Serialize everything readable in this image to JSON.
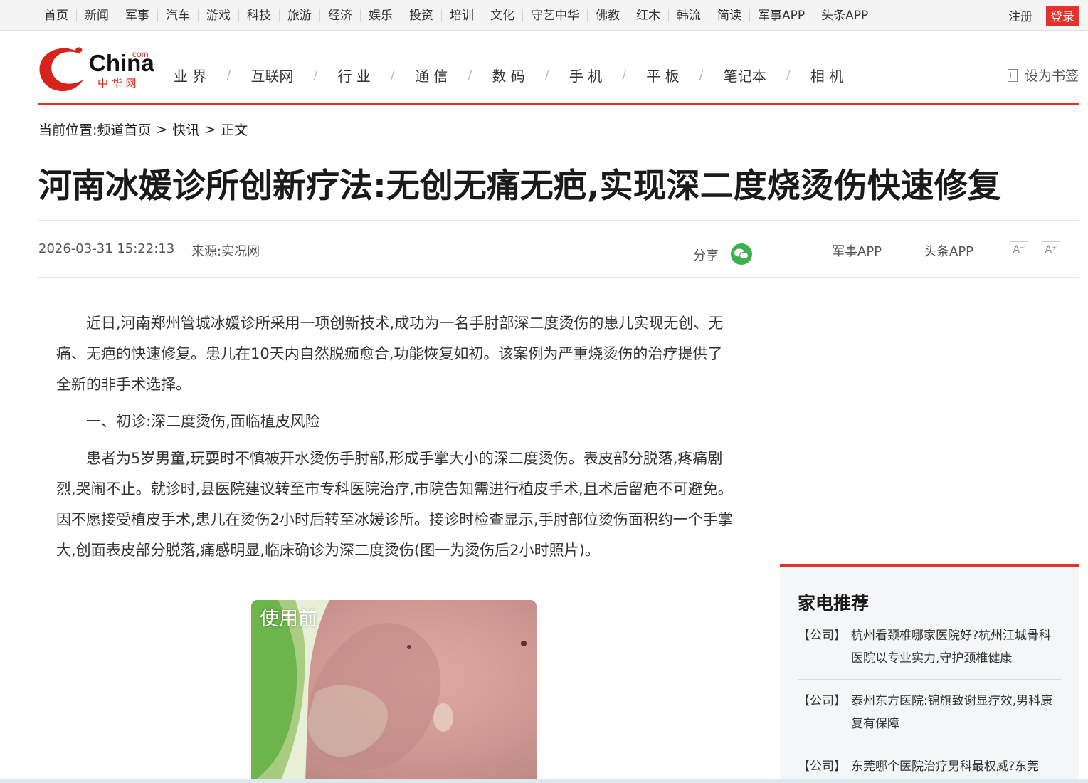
{
  "topbar": {
    "links": [
      "首页",
      "新闻",
      "军事",
      "汽车",
      "游戏",
      "科技",
      "旅游",
      "经济",
      "娱乐",
      "投资",
      "培训",
      "文化",
      "守艺中华",
      "佛教",
      "红木",
      "韩流",
      "简读",
      "军事APP",
      "头条APP"
    ],
    "register": "注册",
    "login": "登录"
  },
  "logo": {
    "text": "China",
    "sup": "com",
    "cn": "中 华 网"
  },
  "mainnav": {
    "items": [
      "业 界",
      "互联网",
      "行 业",
      "通 信",
      "数 码",
      "手 机",
      "平 板",
      "笔记本",
      "相 机"
    ],
    "separator": "/"
  },
  "bookmark": {
    "label": "设为书签",
    "icon": "bookmark-icon"
  },
  "breadcrumb": {
    "prefix": "当前位置:",
    "items": [
      "频道首页",
      "快讯",
      "正文"
    ],
    "separator": ">"
  },
  "article": {
    "title": "河南冰媛诊所创新疗法:无创无痛无疤,实现深二度烧烫伤快速修复",
    "date": "2026-03-31 15:22:13",
    "source": "来源:实况网",
    "share_label": "分享",
    "apps": [
      "军事APP",
      "头条APP"
    ],
    "font_smaller": "A⁻",
    "font_larger": "A⁺",
    "paragraphs": [
      "近日,河南郑州管城冰媛诊所采用一项创新技术,成功为一名手肘部深二度烫伤的患儿实现无创、无痛、无疤的快速修复。患儿在10天内自然脱痂愈合,功能恢复如初。该案例为严重烧烫伤的治疗提供了全新的非手术选择。",
      "一、初诊:深二度烫伤,面临植皮风险",
      "患者为5岁男童,玩耍时不慎被开水烫伤手肘部,形成手掌大小的深二度烫伤。表皮部分脱落,疼痛剧烈,哭闹不止。就诊时,县医院建议转至市专科医院治疗,市院告知需进行植皮手术,且术后留疤不可避免。因不愿接受植皮手术,患儿在烫伤2小时后转至冰媛诊所。接诊时检查显示,手肘部位烫伤面积约一个手掌大,创面表皮部分脱落,痛感明显,临床确诊为深二度烫伤(图一为烫伤后2小时照片)。"
    ],
    "photo_label": "使用前"
  },
  "sidebar": {
    "title": "家电推荐",
    "items": [
      {
        "tag": "【公司】",
        "text": "杭州看颈椎哪家医院好?杭州江城骨科医院以专业实力,守护颈椎健康"
      },
      {
        "tag": "【公司】",
        "text": "泰州东方医院:锦旗致谢显疗效,男科康复有保障"
      },
      {
        "tag": "【公司】",
        "text": "东莞哪个医院治疗男科最权威?东莞"
      }
    ]
  },
  "colors": {
    "accent": "#e2322b",
    "wechat": "#3fb14c"
  }
}
